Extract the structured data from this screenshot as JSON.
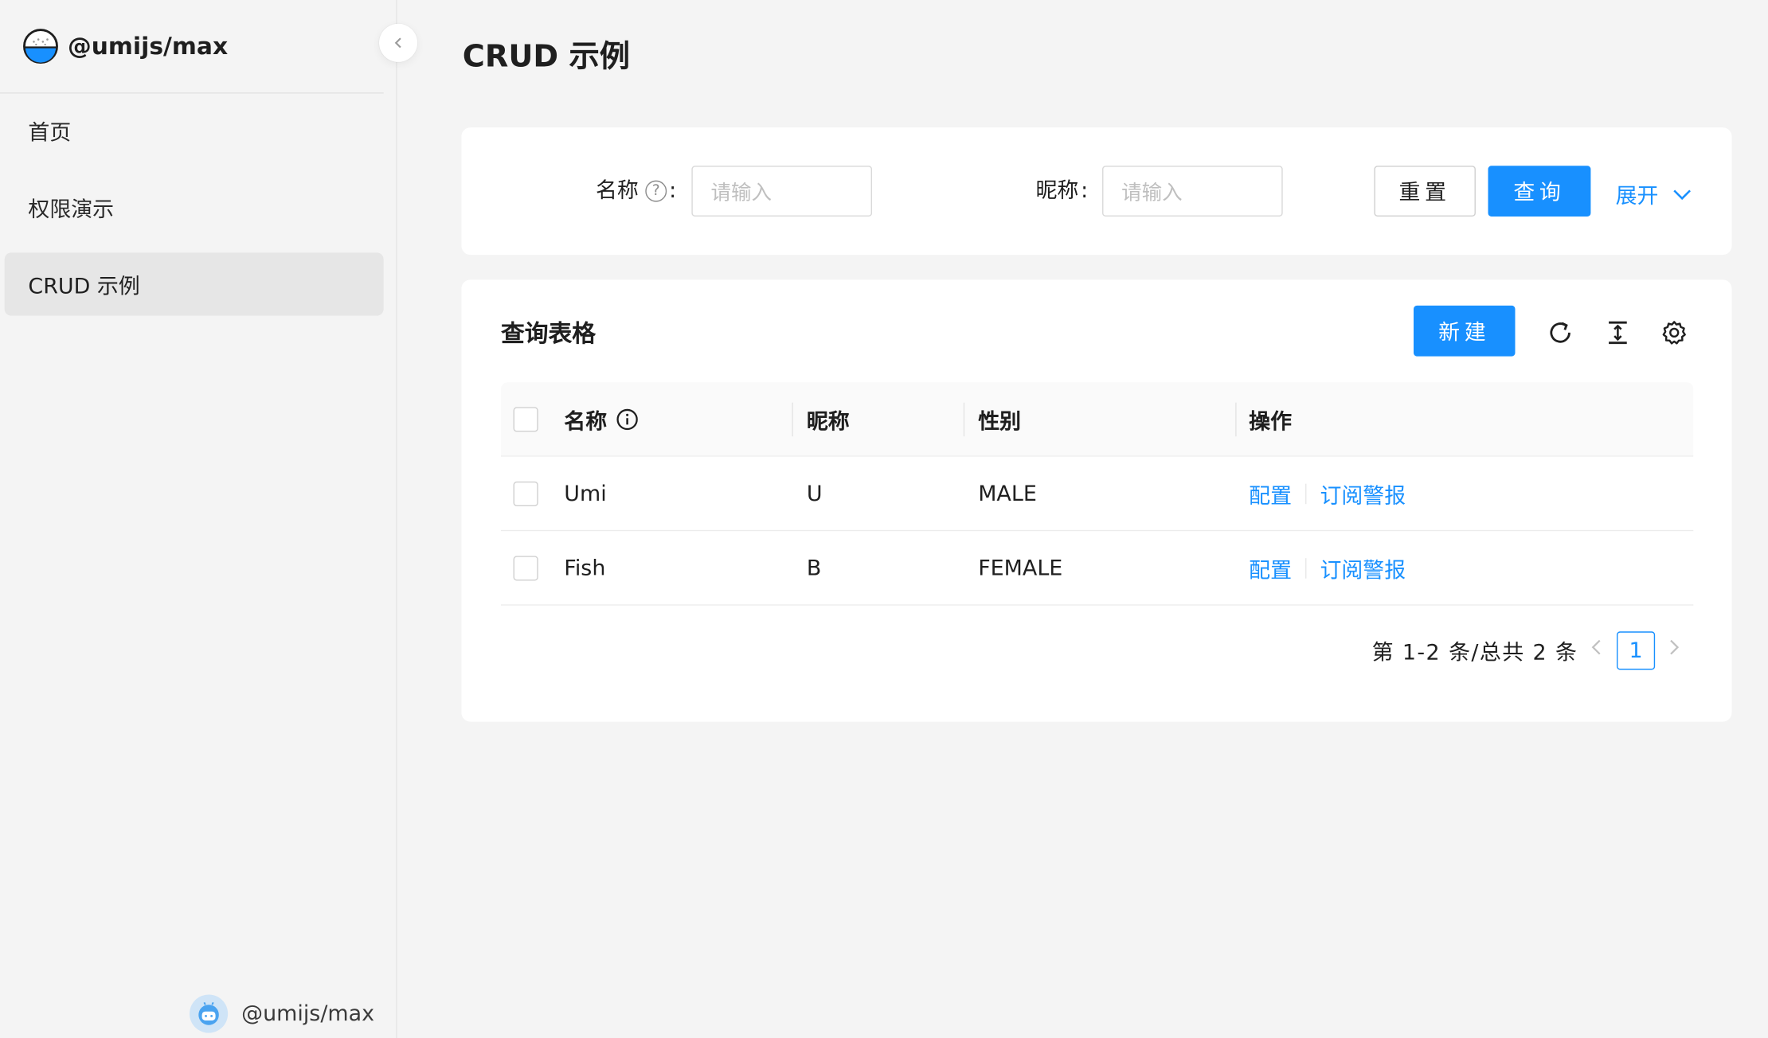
{
  "app": {
    "title": "@umijs/max"
  },
  "sidebar": {
    "items": [
      {
        "label": "首页",
        "active": false
      },
      {
        "label": "权限演示",
        "active": false
      },
      {
        "label": "CRUD 示例",
        "active": true
      }
    ],
    "footer_name": "@umijs/max"
  },
  "page": {
    "title": "CRUD 示例"
  },
  "search": {
    "name_label": "名称",
    "name_placeholder": "请输入",
    "nickname_label": "昵称",
    "nickname_placeholder": "请输入",
    "reset_label": "重置",
    "query_label": "查询",
    "expand_label": "展开"
  },
  "table": {
    "title": "查询表格",
    "new_label": "新建",
    "columns": [
      "名称",
      "昵称",
      "性别",
      "操作"
    ],
    "rows": [
      {
        "name": "Umi",
        "nickname": "U",
        "gender": "MALE"
      },
      {
        "name": "Fish",
        "nickname": "B",
        "gender": "FEMALE"
      }
    ],
    "actions": {
      "config": "配置",
      "subscribe": "订阅警报"
    }
  },
  "pagination": {
    "total_text": "第 1-2 条/总共 2 条",
    "current_page": "1"
  },
  "colors": {
    "primary": "#1890ff",
    "background": "#f4f4f4"
  }
}
